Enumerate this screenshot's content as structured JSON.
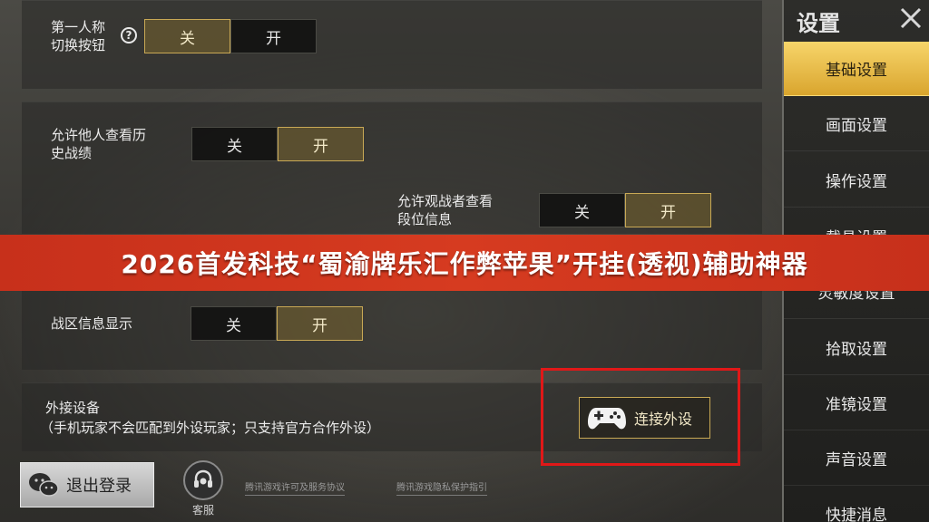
{
  "settings": [
    {
      "label_line1": "第一人称",
      "label_line2": "切换按钮",
      "help": "?",
      "off": "关",
      "on": "开",
      "active": "off"
    },
    {
      "label_line1": "允许他人查看历",
      "label_line2": "史战绩",
      "off": "关",
      "on": "开",
      "active": "on"
    },
    {
      "label_line1": "允许观战者查看",
      "label_line2": "段位信息",
      "off": "关",
      "on": "开",
      "active": "on"
    },
    {
      "label_line1": "战区信息显示",
      "off": "关",
      "on": "开",
      "active": "on"
    }
  ],
  "external_device": {
    "title": "外接设备",
    "note": "（手机玩家不会匹配到外设玩家；只支持官方合作外设）",
    "button_label": "连接外设",
    "button_icon": "gamepad-icon"
  },
  "banner": "2026首发科技“蜀渝牌乐汇作弊苹果”开挂(透视)辅助神器",
  "footer": {
    "logout_label": "退出登录",
    "logout_icon": "wechat-icon",
    "support_label": "客服",
    "links": [
      "腾讯游戏许可及服务协议",
      "腾讯游戏隐私保护指引"
    ]
  },
  "sidebar": {
    "title": "设置",
    "items": [
      "基础设置",
      "画面设置",
      "操作设置",
      "载具设置",
      "灵敏度设置",
      "拾取设置",
      "准镜设置",
      "声音设置",
      "快捷消息"
    ],
    "active_index": 0
  },
  "colors": {
    "accent_gold": "#c9a955",
    "active_tab": "#f0c552",
    "banner_red": "#d63b20",
    "highlight_box": "#e01818"
  }
}
